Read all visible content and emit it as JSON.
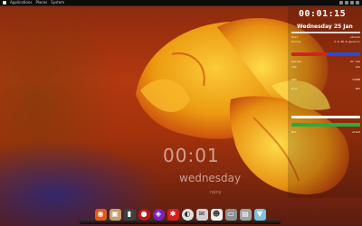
{
  "top_panel": {
    "menus": [
      "Applications",
      "Places",
      "System"
    ],
    "tray_icons": [
      "network-icon",
      "volume-icon",
      "battery-icon",
      "user-icon"
    ]
  },
  "wallpaper_widget": {
    "time": "00:01",
    "day": "wednesday",
    "weather": "rainy"
  },
  "conky": {
    "time": "00:01:15",
    "date": "Wednesday 25 Jan",
    "sections": [
      {
        "label": "Host",
        "value": "ubuntu"
      },
      {
        "label": "Kernel",
        "value": "2.6.38-8-generic"
      },
      {
        "label": "Uptime",
        "value": "0h 12m"
      },
      {
        "label": "CPU",
        "value": "12%"
      },
      {
        "label": "RAM",
        "value": "742MB"
      },
      {
        "label": "Disk",
        "value": "38%"
      },
      {
        "label": "Net",
        "value": "wlan0"
      }
    ],
    "colors": {
      "bar_red": "#d82020",
      "bar_blue": "#2050e0",
      "bar_green": "#20b040",
      "bar_white": "#ffffff"
    }
  },
  "dock": {
    "items": [
      {
        "name": "firefox-icon",
        "glyph": "◉",
        "color": "#e05a1a"
      },
      {
        "name": "files-icon",
        "glyph": "▣",
        "color": "#c0a070"
      },
      {
        "name": "terminal-icon",
        "glyph": "▮",
        "color": "#404040"
      },
      {
        "name": "chat-icon",
        "glyph": "●",
        "color": "#c01818"
      },
      {
        "name": "media-icon",
        "glyph": "◈",
        "color": "#8020c0"
      },
      {
        "name": "settings-icon",
        "glyph": "✱",
        "color": "#d02020"
      },
      {
        "name": "browser-icon",
        "glyph": "◐",
        "color": "#e0e0e0"
      },
      {
        "name": "mail-icon",
        "glyph": "✉",
        "color": "#d0d0d0"
      },
      {
        "name": "ghost-icon",
        "glyph": "☻",
        "color": "#f0f0f0"
      },
      {
        "name": "monitor-icon",
        "glyph": "▭",
        "color": "#909090"
      },
      {
        "name": "printer-icon",
        "glyph": "▤",
        "color": "#a0a0a0"
      },
      {
        "name": "trash-icon",
        "glyph": "▼",
        "color": "#80c0e0"
      }
    ]
  }
}
